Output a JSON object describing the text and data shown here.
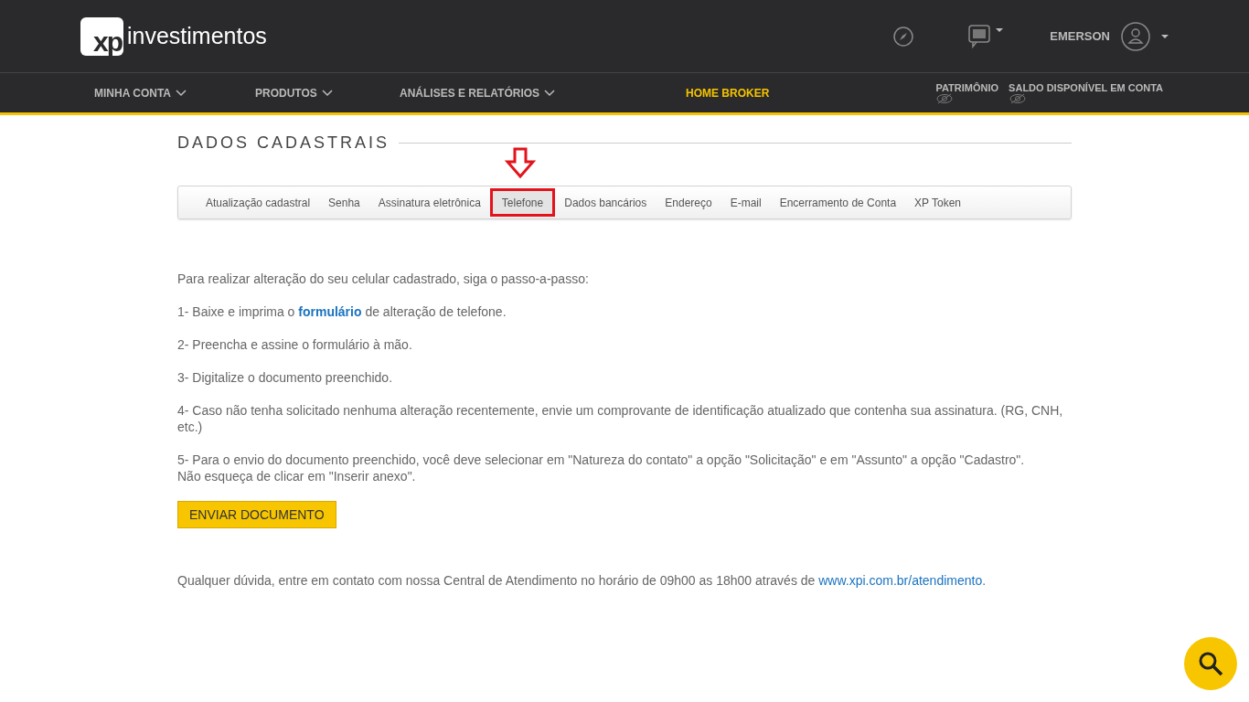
{
  "header": {
    "logo_mark": "xp",
    "logo_text": "investimentos",
    "user": "EMERSON"
  },
  "nav": {
    "items": [
      {
        "label": "MINHA CONTA",
        "kind": "dropdown"
      },
      {
        "label": "PRODUTOS",
        "kind": "dropdown"
      },
      {
        "label": "ANÁLISES E RELATÓRIOS",
        "kind": "dropdown"
      },
      {
        "label": "HOME BROKER",
        "kind": "highlight"
      }
    ],
    "balances": [
      "PATRIMÔNIO",
      "SALDO DISPONÍVEL EM CONTA"
    ]
  },
  "page_title": "DADOS CADASTRAIS",
  "tabs": [
    {
      "label": "Atualização cadastral",
      "selected": false
    },
    {
      "label": "Senha",
      "selected": false
    },
    {
      "label": "Assinatura eletrônica",
      "selected": false
    },
    {
      "label": "Telefone",
      "selected": true
    },
    {
      "label": "Dados bancários",
      "selected": false
    },
    {
      "label": "Endereço",
      "selected": false
    },
    {
      "label": "E-mail",
      "selected": false
    },
    {
      "label": "Encerramento de Conta",
      "selected": false
    },
    {
      "label": "XP Token",
      "selected": false
    }
  ],
  "intro": "Para realizar alteração do seu celular cadastrado, siga o passo-a-passo:",
  "steps": [
    {
      "before": "1- Baixe e imprima o ",
      "link": "formulário",
      "after": " de alteração de telefone."
    },
    {
      "before": "2- Preencha e assine o formulário à mão."
    },
    {
      "before": "3- Digitalize o documento preenchido."
    },
    {
      "before": "4- Caso não tenha solicitado nenhuma alteração recentemente, envie um comprovante de identificação atualizado que contenha sua assinatura. (RG, CNH, etc.)"
    },
    {
      "before": "5- Para o envio do documento preenchido, você deve selecionar em \"Natureza do contato\" a opção \"Solicitação\" e em \"Assunto\" a opção \"Cadastro\".",
      "line2": "Não esqueça de clicar em \"Inserir anexo\"."
    }
  ],
  "button": "ENVIAR DOCUMENTO",
  "footer": {
    "text": "Qualquer dúvida, entre em contato com nossa Central de Atendimento no horário de 09h00 as 18h00 através de ",
    "link": "www.xpi.com.br/atendimento",
    "end": "."
  }
}
